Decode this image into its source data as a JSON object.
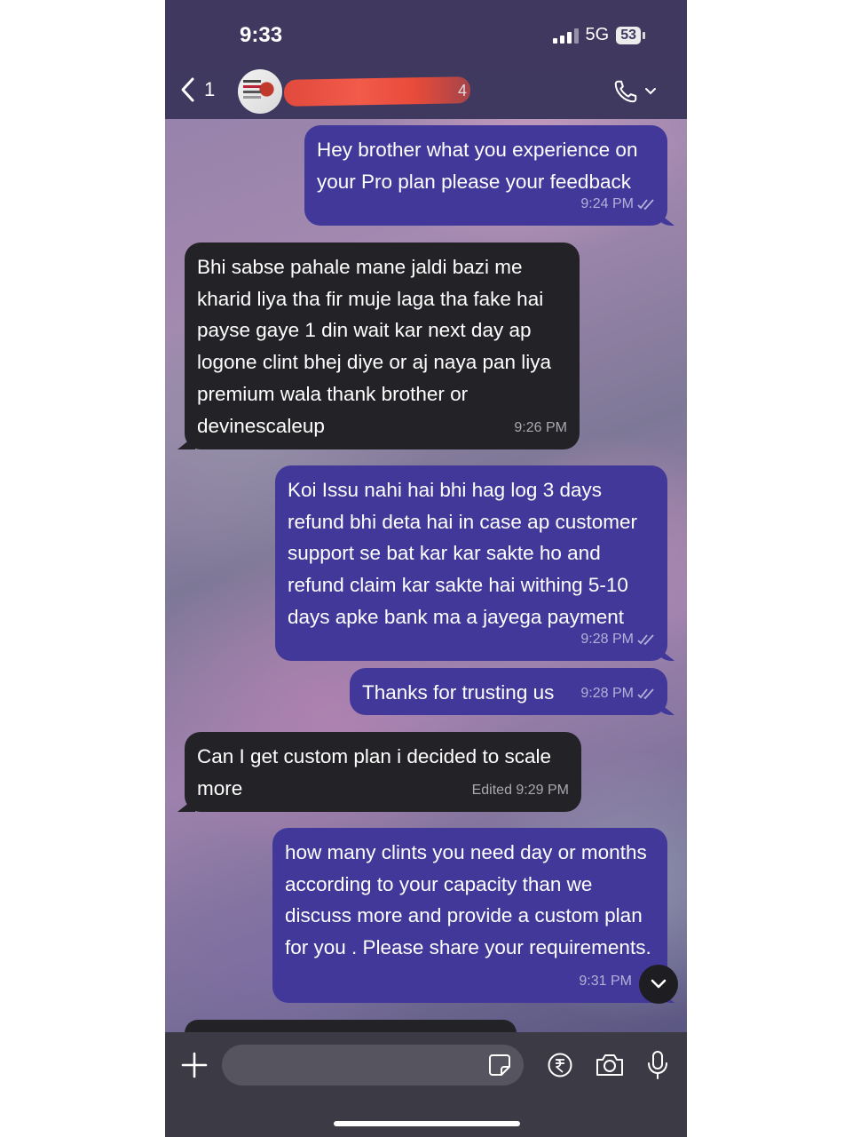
{
  "status_bar": {
    "time": "9:33",
    "network": "5G",
    "battery": "53"
  },
  "header": {
    "back_count": "1",
    "contact_name_fragment": "4",
    "call_label": "call"
  },
  "messages": [
    {
      "direction": "out",
      "text": "Hey brother what you experience on your Pro plan please your feedback",
      "time": "9:24 PM",
      "read": true
    },
    {
      "direction": "in",
      "text": "Bhi sabse pahale mane jaldi bazi me kharid liya tha fir muje laga tha fake hai payse gaye 1 din wait kar next day ap logone clint bhej diye or aj naya pan liya premium wala thank brother or devinescaleup",
      "time": "9:26 PM"
    },
    {
      "direction": "out",
      "text": "Koi Issu nahi hai bhi hag log 3 days refund bhi deta hai in case ap customer support se bat kar kar sakte ho and refund claim kar sakte hai withing 5-10 days apke bank ma a jayega payment",
      "time": "9:28 PM",
      "read": true
    },
    {
      "direction": "out",
      "text": "Thanks for trusting us",
      "time": "9:28 PM",
      "read": true
    },
    {
      "direction": "in",
      "text": "Can I get custom plan i decided to scale more",
      "time": "Edited 9:29 PM"
    },
    {
      "direction": "out",
      "text": "how many clints you need day or months according to your capacity than we discuss more and provide a custom plan for you . Please share your requirements.",
      "time": "9:31 PM",
      "read": true
    }
  ],
  "composer": {
    "placeholder": ""
  },
  "icons": [
    "chevron-left-icon",
    "phone-icon",
    "chevron-down-icon",
    "plus-icon",
    "sticker-icon",
    "rupee-icon",
    "camera-icon",
    "mic-icon",
    "double-check-icon"
  ],
  "colors": {
    "outgoing_bubble": "#42389a",
    "incoming_bubble": "#232327",
    "header": "#40385e",
    "composer": "#3c3a44"
  }
}
